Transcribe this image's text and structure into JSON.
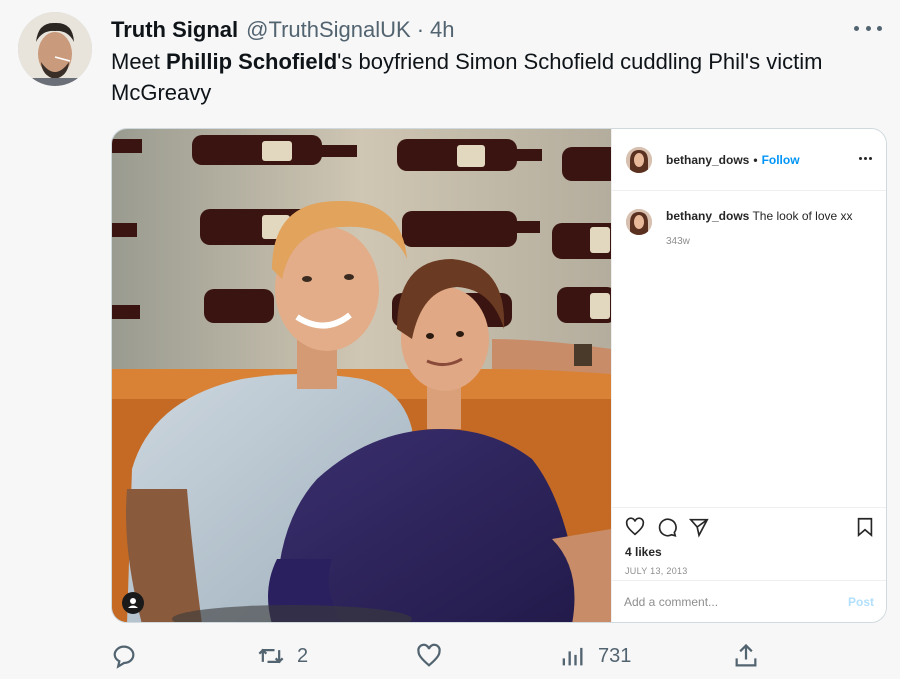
{
  "tweet": {
    "display_name": "Truth Signal",
    "handle": "@TruthSignalUK",
    "separator": "·",
    "time": "4h",
    "text_before": "Meet ",
    "text_bold": "Phillip Schofield",
    "text_after": "'s boyfriend Simon Schofield cuddling Phil's victim McGreavy"
  },
  "instagram": {
    "username": "bethany_dows",
    "bullet": "•",
    "follow_label": "Follow",
    "caption_user": "bethany_dows",
    "caption_text": " The look of love xx",
    "caption_age": "343w",
    "likes": "4 likes",
    "date": "JULY 13, 2013",
    "comment_placeholder": "Add a comment...",
    "post_label": "Post"
  },
  "actions": {
    "retweets": "2",
    "views": "731"
  },
  "icons": [
    "more-icon",
    "user-tag-icon",
    "heart-icon",
    "comment-icon",
    "share-icon",
    "bookmark-icon",
    "reply-icon",
    "retweet-icon",
    "like-icon",
    "views-icon",
    "upload-icon"
  ]
}
